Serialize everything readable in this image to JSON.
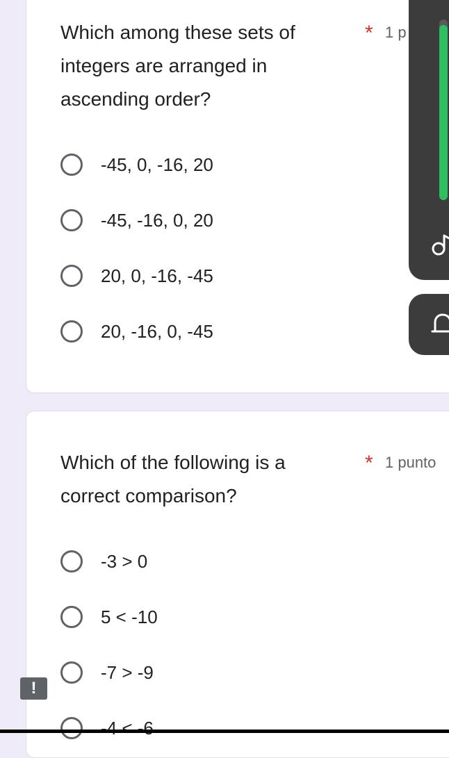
{
  "questions": [
    {
      "title": "Which among these sets of integers are arranged in ascending order?",
      "required_mark": "*",
      "points": "1 p",
      "options": [
        "-45, 0, -16, 20",
        "-45, -16, 0, 20",
        "20, 0, -16, -45",
        "20, -16, 0, -45"
      ]
    },
    {
      "title": "Which of the following is a correct comparison?",
      "required_mark": "*",
      "points": "1 punto",
      "options": [
        "-3 > 0",
        "5 < -10",
        "-7 > -9",
        "-4 < -6"
      ]
    }
  ],
  "overlay": {
    "volume_level": 0.97,
    "volume_color": "#2fbf63",
    "volume_icon": "music-note-icon",
    "notify_icon": "bell-icon"
  },
  "alert_badge": "!",
  "colors": {
    "background": "#f0ebf8",
    "required": "#d93025",
    "panel": "#3c3c3c"
  }
}
